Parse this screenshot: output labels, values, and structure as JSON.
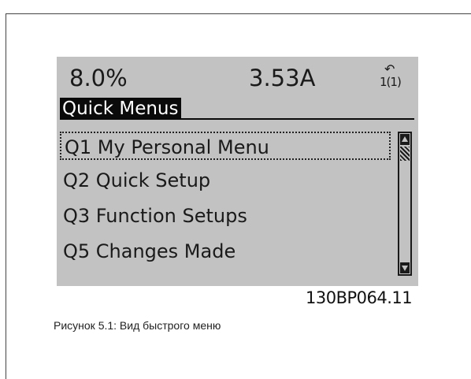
{
  "display": {
    "status": {
      "left_value": "8.0%",
      "mid_value": "3.53A",
      "setup_symbol": "↶",
      "setup_indicator": "1(1)"
    },
    "title": "Quick Menus",
    "items": [
      {
        "label": "Q1 My Personal Menu",
        "selected": true
      },
      {
        "label": "Q2 Quick Setup",
        "selected": false
      },
      {
        "label": "Q3 Function Setups",
        "selected": false
      },
      {
        "label": "Q5 Changes Made",
        "selected": false
      }
    ]
  },
  "figure_code": "130BP064.11",
  "caption": "Рисунок 5.1: Вид быстрого меню"
}
